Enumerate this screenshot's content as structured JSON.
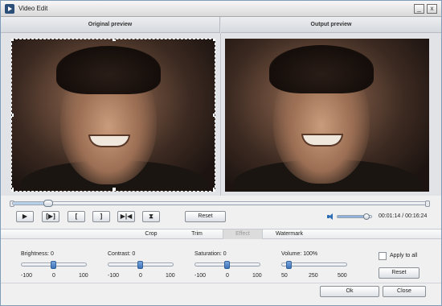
{
  "window": {
    "title": "Video Edit",
    "minimize_glyph": "_",
    "close_glyph": "x"
  },
  "preview": {
    "original_label": "Original preview",
    "output_label": "Output preview"
  },
  "playback": {
    "position_fraction": 0.085,
    "buttons": {
      "play": "▶",
      "step": "[▶]",
      "mark_in": "[",
      "mark_out": "]",
      "next_clip": "▶|◀",
      "split": "⧗"
    },
    "reset_label": "Reset",
    "volume_fraction": 0.85,
    "time_text": "00:01:14 / 00:16:24"
  },
  "tabs": [
    {
      "label": "Crop",
      "active": false
    },
    {
      "label": "Trim",
      "active": false
    },
    {
      "label": "Effect",
      "active": true
    },
    {
      "label": "Watermark",
      "active": false
    }
  ],
  "effects": {
    "brightness": {
      "label": "Brightness: 0",
      "value": 0,
      "min_label": "-100",
      "mid_label": "0",
      "max_label": "100",
      "min": -100,
      "max": 100
    },
    "contrast": {
      "label": "Contrast: 0",
      "value": 0,
      "min_label": "-100",
      "mid_label": "0",
      "max_label": "100",
      "min": -100,
      "max": 100
    },
    "saturation": {
      "label": "Saturation: 0",
      "value": 0,
      "min_label": "-100",
      "mid_label": "0",
      "max_label": "100",
      "min": -100,
      "max": 100
    },
    "volume": {
      "label": "Volume: 100%",
      "value": 100,
      "min_label": "50",
      "mid_label": "250",
      "max_label": "500",
      "min": 50,
      "max": 500
    },
    "apply_to_all_label": "Apply to all",
    "apply_to_all_checked": false,
    "reset_label": "Reset"
  },
  "footer": {
    "ok_label": "Ok",
    "close_label": "Close"
  },
  "icons": [
    "app-icon",
    "minimize-icon",
    "close-icon",
    "speaker-icon"
  ]
}
